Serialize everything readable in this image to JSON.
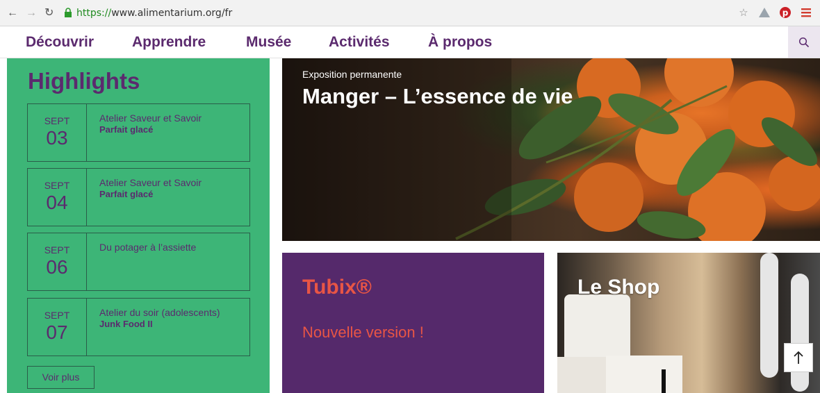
{
  "browser": {
    "url_scheme": "https://",
    "url_rest": "www.alimentarium.org/fr",
    "icons": [
      "back-icon",
      "forward-icon",
      "reload-icon",
      "lock-icon",
      "star-icon",
      "extension-icon",
      "pinterest-icon",
      "menu-icon"
    ]
  },
  "nav": {
    "items": [
      "Découvrir",
      "Apprendre",
      "Musée",
      "Activités",
      "À propos"
    ]
  },
  "highlights": {
    "title": "Highlights",
    "events": [
      {
        "month": "SEPT",
        "day": "03",
        "line1": "Atelier Saveur et Savoir",
        "line2": "Parfait glacé"
      },
      {
        "month": "SEPT",
        "day": "04",
        "line1": "Atelier Saveur et Savoir",
        "line2": "Parfait glacé"
      },
      {
        "month": "SEPT",
        "day": "06",
        "line1": "Du potager à l’assiette",
        "line2": ""
      },
      {
        "month": "SEPT",
        "day": "07",
        "line1": "Atelier du soir (adolescents)",
        "line2": "Junk Food II"
      }
    ],
    "more_label": "Voir plus"
  },
  "hero": {
    "kicker": "Exposition permanente",
    "heading": "Manger – L’essence de vie"
  },
  "tubix": {
    "heading": "Tubix®",
    "subtitle": "Nouvelle version !"
  },
  "shop": {
    "heading": "Le Shop"
  },
  "colors": {
    "purple": "#5b2a6e",
    "green": "#3db577",
    "tubix_bg": "#55296b",
    "tubix_text": "#e85545"
  }
}
